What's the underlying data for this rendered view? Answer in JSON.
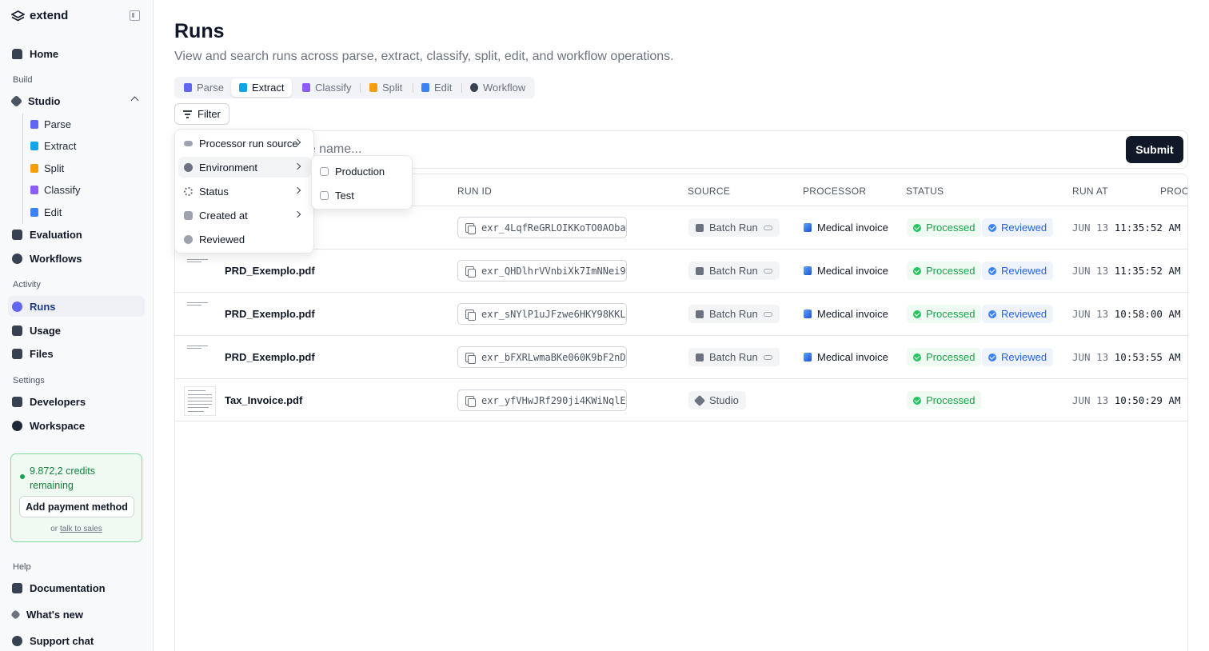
{
  "app": {
    "brand": "extend"
  },
  "sidebar": {
    "home": "Home",
    "build_label": "Build",
    "studio": "Studio",
    "studio_items": [
      "Parse",
      "Extract",
      "Split",
      "Classify",
      "Edit"
    ],
    "evaluation": "Evaluation",
    "workflows": "Workflows",
    "activity_label": "Activity",
    "runs": "Runs",
    "usage": "Usage",
    "files": "Files",
    "settings_label": "Settings",
    "developers": "Developers",
    "workspace": "Workspace",
    "credits_text": "9.872,2 credits remaining",
    "add_payment": "Add payment method",
    "or_text": "or",
    "talk_to_sales": "talk to sales",
    "help_label": "Help",
    "documentation": "Documentation",
    "whats_new": "What's new",
    "support_chat": "Support chat"
  },
  "page": {
    "title": "Runs",
    "subtitle": "View and search runs across parse, extract, classify, split, edit, and workflow operations."
  },
  "tabs": [
    {
      "label": "Parse",
      "color": "#6366f1"
    },
    {
      "label": "Extract",
      "color": "#0ea5e9"
    },
    {
      "label": "Classify",
      "color": "#8b5cf6"
    },
    {
      "label": "Split",
      "color": "#f59e0b"
    },
    {
      "label": "Edit",
      "color": "#3b82f6"
    },
    {
      "label": "Workflow",
      "color": "#374151"
    }
  ],
  "filter": {
    "label": "Filter"
  },
  "search": {
    "placeholder": "Search by run ID or file name...",
    "submit": "Submit"
  },
  "table": {
    "headers": [
      "RUN ID",
      "SOURCE",
      "PROCESSOR",
      "STATUS",
      "RUN AT",
      "PROCE"
    ],
    "rows": [
      {
        "file": "",
        "run_id": "exr_4LqfReGRLOIKKoTO0AOba",
        "source": "Batch Run",
        "processor": "Medical invoice",
        "status": "Processed",
        "reviewed": "Reviewed",
        "date": "JUN 13",
        "time": "11:35:52 AM"
      },
      {
        "file": "PRD_Exemplo.pdf",
        "run_id": "exr_QHDlhrVVnbiXk7ImNNei9",
        "source": "Batch Run",
        "processor": "Medical invoice",
        "status": "Processed",
        "reviewed": "Reviewed",
        "date": "JUN 13",
        "time": "11:35:52 AM"
      },
      {
        "file": "PRD_Exemplo.pdf",
        "run_id": "exr_sNYlP1uJFzwe6HKY98KKL",
        "source": "Batch Run",
        "processor": "Medical invoice",
        "status": "Processed",
        "reviewed": "Reviewed",
        "date": "JUN 13",
        "time": "10:58:00 AM"
      },
      {
        "file": "PRD_Exemplo.pdf",
        "run_id": "exr_bFXRLwmaBKe060K9bF2nD",
        "source": "Batch Run",
        "processor": "Medical invoice",
        "status": "Processed",
        "reviewed": "Reviewed",
        "date": "JUN 13",
        "time": "10:53:55 AM"
      },
      {
        "file": "Tax_Invoice.pdf",
        "run_id": "exr_yfVHwJRf290ji4KWiNqlE",
        "source": "Studio",
        "processor": "",
        "status": "Processed",
        "reviewed": "",
        "date": "JUN 13",
        "time": "10:50:29 AM"
      }
    ]
  },
  "filter_menu": {
    "items": [
      "Processor run source",
      "Environment",
      "Status",
      "Created at",
      "Reviewed"
    ],
    "environment_options": [
      "Production",
      "Test"
    ]
  }
}
